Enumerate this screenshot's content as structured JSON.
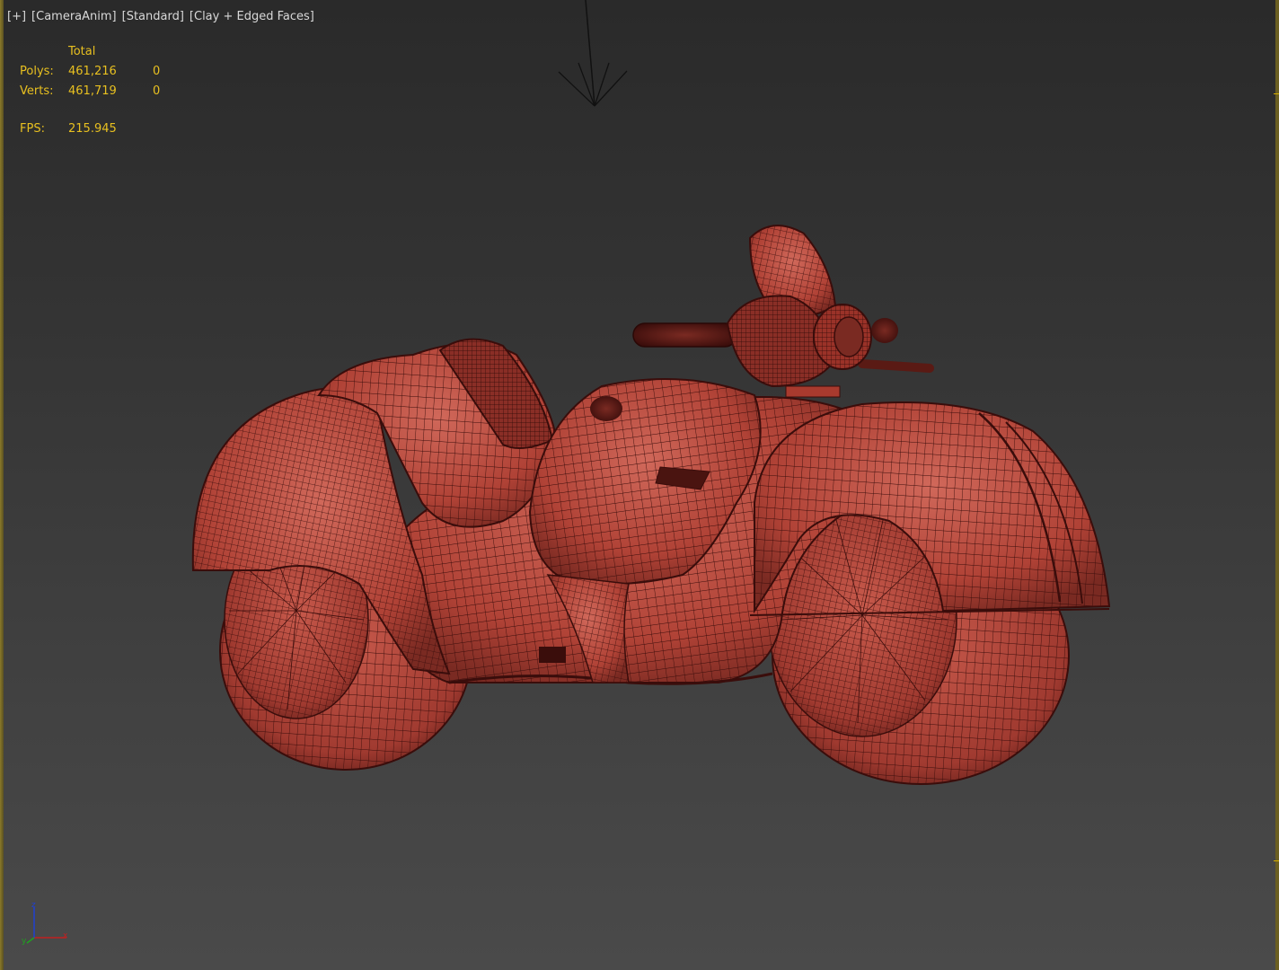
{
  "viewport": {
    "labels": {
      "menu": "[+]",
      "camera": "[CameraAnim]",
      "style": "[Standard]",
      "shading": "[Clay + Edged Faces]"
    },
    "stats": {
      "header_total": "Total",
      "polys_label": "Polys:",
      "polys_total": "461,216",
      "polys_selected": "0",
      "verts_label": "Verts:",
      "verts_total": "461,719",
      "verts_selected": "0",
      "fps_label": "FPS:",
      "fps_value": "215.945"
    },
    "axis_gizmo": {
      "x_label": "x",
      "y_label": "y",
      "z_label": "z"
    }
  },
  "colors": {
    "stats_text": "#e8c020",
    "clay": "#b5473a",
    "wire": "#3a0d0b",
    "axis_x": "#c02020",
    "axis_y": "#20a020",
    "axis_z": "#2040d0"
  },
  "objects": {
    "icons": [
      "camera-target-icon",
      "axis-gizmo-icon"
    ],
    "model": "motorcycle-mesh"
  }
}
